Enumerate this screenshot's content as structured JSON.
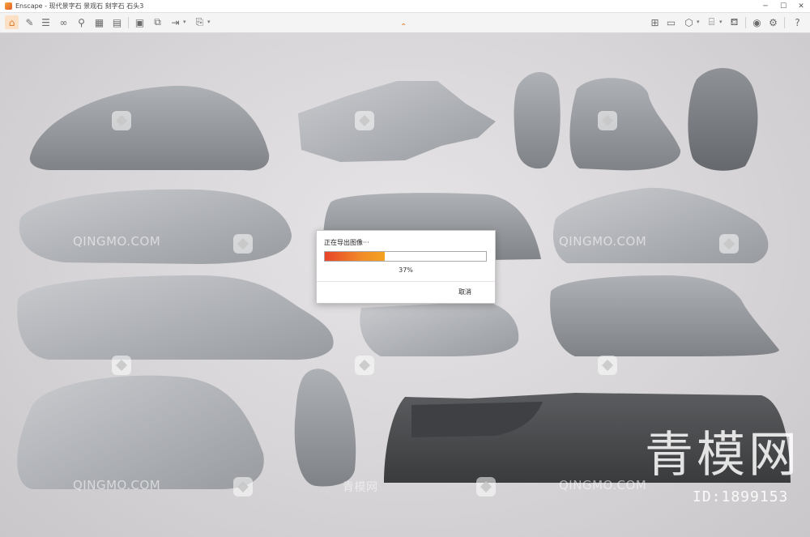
{
  "window": {
    "app_icon": "enscape-logo-icon",
    "title": "Enscape - 现代景字石 景观石 刻字石 石头3",
    "controls": [
      "minimize-icon",
      "maximize-icon",
      "close-icon"
    ]
  },
  "toolbar": {
    "left_tools": [
      "home-icon",
      "tag-icon",
      "list-icon",
      "binoculars-icon",
      "pin-icon",
      "box-icon",
      "grid-icon",
      "clapper-icon",
      "export-image-icon",
      "export-batch-icon",
      "export-panorama-icon",
      "export-file-icon"
    ],
    "right_tools": [
      "map-icon",
      "layout-icon",
      "cube-icon",
      "assets-icon",
      "cup-icon",
      "eye-icon",
      "settings-icon",
      "help-icon"
    ],
    "accent_color": "#e07a26",
    "collapse_icon": "chevron-up-icon"
  },
  "viewport": {
    "watermark_text": "QINGMO.COM",
    "watermark_cn": "青模网",
    "brand_text": "青模网",
    "id_text": "ID:1899153"
  },
  "export_dialog": {
    "title": "正在导出图像···",
    "progress_percent": 37,
    "progress_label": "37%",
    "cancel_label": "取消"
  }
}
